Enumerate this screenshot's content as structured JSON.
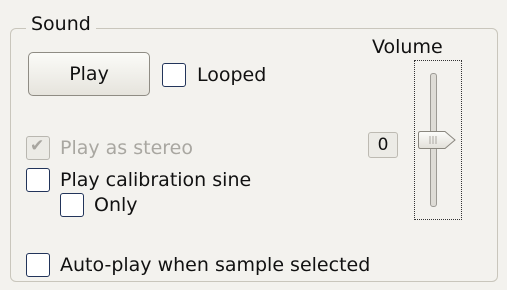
{
  "group": {
    "title": "Sound"
  },
  "play_button": {
    "label": "Play"
  },
  "looped": {
    "label": "Looped",
    "checked": false
  },
  "play_as_stereo": {
    "label": "Play as stereo",
    "checked": true,
    "enabled": false
  },
  "play_calibration_sine": {
    "label": "Play calibration sine",
    "checked": false
  },
  "only": {
    "label": "Only",
    "checked": false
  },
  "auto_play": {
    "label": "Auto-play when sample selected",
    "checked": false
  },
  "volume": {
    "label": "Volume",
    "value": "0",
    "level": 0.5
  }
}
